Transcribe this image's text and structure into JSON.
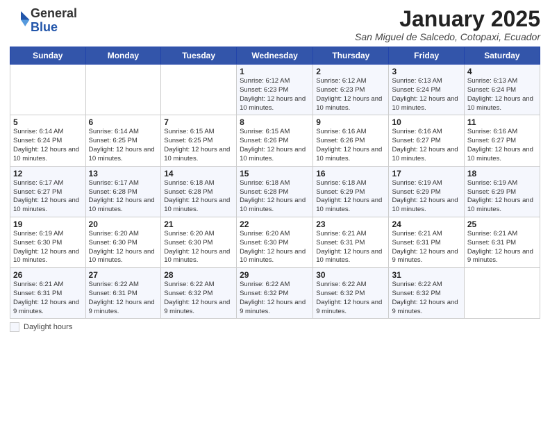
{
  "logo": {
    "general": "General",
    "blue": "Blue"
  },
  "header": {
    "month_title": "January 2025",
    "subtitle": "San Miguel de Salcedo, Cotopaxi, Ecuador"
  },
  "days_of_week": [
    "Sunday",
    "Monday",
    "Tuesday",
    "Wednesday",
    "Thursday",
    "Friday",
    "Saturday"
  ],
  "weeks": [
    [
      {
        "day": "",
        "info": ""
      },
      {
        "day": "",
        "info": ""
      },
      {
        "day": "",
        "info": ""
      },
      {
        "day": "1",
        "info": "Sunrise: 6:12 AM\nSunset: 6:23 PM\nDaylight: 12 hours and 10 minutes."
      },
      {
        "day": "2",
        "info": "Sunrise: 6:12 AM\nSunset: 6:23 PM\nDaylight: 12 hours and 10 minutes."
      },
      {
        "day": "3",
        "info": "Sunrise: 6:13 AM\nSunset: 6:24 PM\nDaylight: 12 hours and 10 minutes."
      },
      {
        "day": "4",
        "info": "Sunrise: 6:13 AM\nSunset: 6:24 PM\nDaylight: 12 hours and 10 minutes."
      }
    ],
    [
      {
        "day": "5",
        "info": "Sunrise: 6:14 AM\nSunset: 6:24 PM\nDaylight: 12 hours and 10 minutes."
      },
      {
        "day": "6",
        "info": "Sunrise: 6:14 AM\nSunset: 6:25 PM\nDaylight: 12 hours and 10 minutes."
      },
      {
        "day": "7",
        "info": "Sunrise: 6:15 AM\nSunset: 6:25 PM\nDaylight: 12 hours and 10 minutes."
      },
      {
        "day": "8",
        "info": "Sunrise: 6:15 AM\nSunset: 6:26 PM\nDaylight: 12 hours and 10 minutes."
      },
      {
        "day": "9",
        "info": "Sunrise: 6:16 AM\nSunset: 6:26 PM\nDaylight: 12 hours and 10 minutes."
      },
      {
        "day": "10",
        "info": "Sunrise: 6:16 AM\nSunset: 6:27 PM\nDaylight: 12 hours and 10 minutes."
      },
      {
        "day": "11",
        "info": "Sunrise: 6:16 AM\nSunset: 6:27 PM\nDaylight: 12 hours and 10 minutes."
      }
    ],
    [
      {
        "day": "12",
        "info": "Sunrise: 6:17 AM\nSunset: 6:27 PM\nDaylight: 12 hours and 10 minutes."
      },
      {
        "day": "13",
        "info": "Sunrise: 6:17 AM\nSunset: 6:28 PM\nDaylight: 12 hours and 10 minutes."
      },
      {
        "day": "14",
        "info": "Sunrise: 6:18 AM\nSunset: 6:28 PM\nDaylight: 12 hours and 10 minutes."
      },
      {
        "day": "15",
        "info": "Sunrise: 6:18 AM\nSunset: 6:28 PM\nDaylight: 12 hours and 10 minutes."
      },
      {
        "day": "16",
        "info": "Sunrise: 6:18 AM\nSunset: 6:29 PM\nDaylight: 12 hours and 10 minutes."
      },
      {
        "day": "17",
        "info": "Sunrise: 6:19 AM\nSunset: 6:29 PM\nDaylight: 12 hours and 10 minutes."
      },
      {
        "day": "18",
        "info": "Sunrise: 6:19 AM\nSunset: 6:29 PM\nDaylight: 12 hours and 10 minutes."
      }
    ],
    [
      {
        "day": "19",
        "info": "Sunrise: 6:19 AM\nSunset: 6:30 PM\nDaylight: 12 hours and 10 minutes."
      },
      {
        "day": "20",
        "info": "Sunrise: 6:20 AM\nSunset: 6:30 PM\nDaylight: 12 hours and 10 minutes."
      },
      {
        "day": "21",
        "info": "Sunrise: 6:20 AM\nSunset: 6:30 PM\nDaylight: 12 hours and 10 minutes."
      },
      {
        "day": "22",
        "info": "Sunrise: 6:20 AM\nSunset: 6:30 PM\nDaylight: 12 hours and 10 minutes."
      },
      {
        "day": "23",
        "info": "Sunrise: 6:21 AM\nSunset: 6:31 PM\nDaylight: 12 hours and 10 minutes."
      },
      {
        "day": "24",
        "info": "Sunrise: 6:21 AM\nSunset: 6:31 PM\nDaylight: 12 hours and 9 minutes."
      },
      {
        "day": "25",
        "info": "Sunrise: 6:21 AM\nSunset: 6:31 PM\nDaylight: 12 hours and 9 minutes."
      }
    ],
    [
      {
        "day": "26",
        "info": "Sunrise: 6:21 AM\nSunset: 6:31 PM\nDaylight: 12 hours and 9 minutes."
      },
      {
        "day": "27",
        "info": "Sunrise: 6:22 AM\nSunset: 6:31 PM\nDaylight: 12 hours and 9 minutes."
      },
      {
        "day": "28",
        "info": "Sunrise: 6:22 AM\nSunset: 6:32 PM\nDaylight: 12 hours and 9 minutes."
      },
      {
        "day": "29",
        "info": "Sunrise: 6:22 AM\nSunset: 6:32 PM\nDaylight: 12 hours and 9 minutes."
      },
      {
        "day": "30",
        "info": "Sunrise: 6:22 AM\nSunset: 6:32 PM\nDaylight: 12 hours and 9 minutes."
      },
      {
        "day": "31",
        "info": "Sunrise: 6:22 AM\nSunset: 6:32 PM\nDaylight: 12 hours and 9 minutes."
      },
      {
        "day": "",
        "info": ""
      }
    ]
  ],
  "legend": {
    "label": "Daylight hours"
  }
}
